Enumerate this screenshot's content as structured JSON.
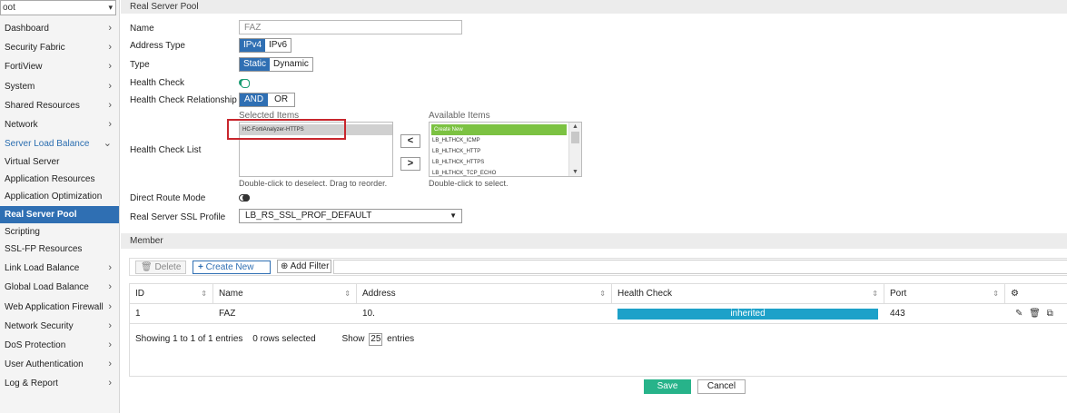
{
  "sidebar": {
    "vdom": "oot",
    "items": [
      {
        "label": "Dashboard",
        "chev": "›"
      },
      {
        "label": "Security Fabric",
        "chev": "›"
      },
      {
        "label": "FortiView",
        "chev": "›"
      },
      {
        "label": "System",
        "chev": "›"
      },
      {
        "label": "Shared Resources",
        "chev": "›"
      },
      {
        "label": "Network",
        "chev": "›"
      },
      {
        "label": "Server Load Balance",
        "chev": "⌄"
      },
      {
        "label": "Virtual Server"
      },
      {
        "label": "Application Resources"
      },
      {
        "label": "Application Optimization"
      },
      {
        "label": "Real Server Pool"
      },
      {
        "label": "Scripting"
      },
      {
        "label": "SSL-FP Resources"
      },
      {
        "label": "Link Load Balance",
        "chev": "›"
      },
      {
        "label": "Global Load Balance",
        "chev": "›"
      },
      {
        "label": "Web Application Firewall",
        "chev": "›"
      },
      {
        "label": "Network Security",
        "chev": "›"
      },
      {
        "label": "DoS Protection",
        "chev": "›"
      },
      {
        "label": "User Authentication",
        "chev": "›"
      },
      {
        "label": "Log & Report",
        "chev": "›"
      }
    ]
  },
  "form": {
    "section_title": "Real Server Pool",
    "name_label": "Name",
    "name_value": "FAZ",
    "address_type_label": "Address Type",
    "address_type_options": [
      "IPv4",
      "IPv6"
    ],
    "type_label": "Type",
    "type_options": [
      "Static",
      "Dynamic"
    ],
    "health_check_label": "Health Check",
    "health_check_on": true,
    "hc_relationship_label": "Health Check Relationship",
    "hc_relationship_options": [
      "AND",
      "OR"
    ],
    "hc_list_label": "Health Check List",
    "selected_items_label": "Selected Items",
    "selected_items": [
      "HC-FortiAnalyzer-HTTPS"
    ],
    "available_items_label": "Available Items",
    "available_items": [
      "Create New",
      "LB_HLTHCK_ICMP",
      "LB_HLTHCK_HTTP",
      "LB_HLTHCK_HTTPS",
      "LB_HLTHCK_TCP_ECHO"
    ],
    "move_left": "<",
    "move_right": ">",
    "selected_hint": "Double-click to deselect. Drag to reorder.",
    "available_hint": "Double-click to select.",
    "direct_route_label": "Direct Route Mode",
    "direct_route_on": false,
    "ssl_profile_label": "Real Server SSL Profile",
    "ssl_profile_value": "LB_RS_SSL_PROF_DEFAULT"
  },
  "member": {
    "section_title": "Member",
    "delete_label": "Delete",
    "create_label": "Create New",
    "filter_label": "Add Filter",
    "columns": [
      "ID",
      "Name",
      "Address",
      "Health Check",
      "Port"
    ],
    "rows": [
      {
        "id": "1",
        "name": "FAZ",
        "address": "10.",
        "health_check": "inherited",
        "port": "443"
      }
    ],
    "summary": "Showing 1 to 1 of 1 entries",
    "selected": "0 rows selected",
    "show_label": "Show",
    "show_value": "25",
    "entries_label": "entries"
  },
  "actions": {
    "save": "Save",
    "cancel": "Cancel"
  },
  "colors": {
    "accent": "#2f6fb3",
    "save": "#27b38a",
    "highlight_box": "#c8262d",
    "health_bar": "#1da1c9"
  }
}
